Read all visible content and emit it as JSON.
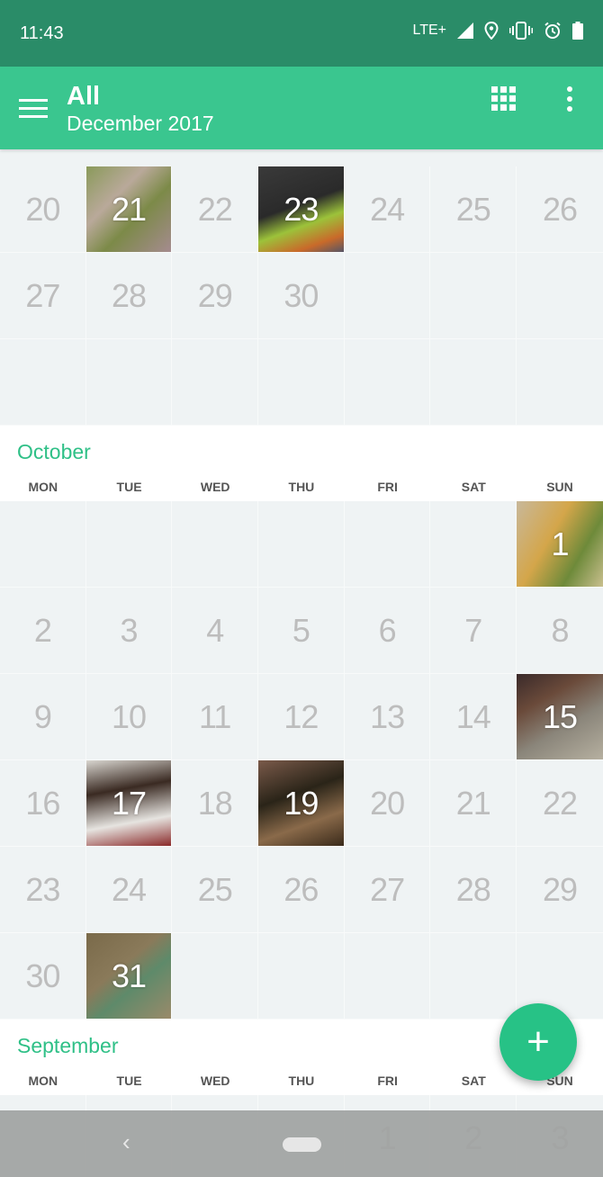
{
  "status_bar": {
    "time": "11:43",
    "network": "LTE+",
    "icons": [
      "signal-icon",
      "location-icon",
      "vibrate-icon",
      "alarm-icon",
      "battery-icon"
    ]
  },
  "app_bar": {
    "title": "All",
    "subtitle": "December 2017",
    "menu_icon": "hamburger-menu-icon",
    "view_icon": "grid-view-icon",
    "more_icon": "more-vert-icon"
  },
  "weekdays": [
    "MON",
    "TUE",
    "WED",
    "THU",
    "FRI",
    "SAT",
    "SUN"
  ],
  "november_partial": {
    "rows": [
      [
        {
          "d": "20"
        },
        {
          "d": "21",
          "photo": "leaves"
        },
        {
          "d": "22"
        },
        {
          "d": "23",
          "photo": "child-eating"
        },
        {
          "d": "24"
        },
        {
          "d": "25"
        },
        {
          "d": "26"
        }
      ],
      [
        {
          "d": "27"
        },
        {
          "d": "28"
        },
        {
          "d": "29"
        },
        {
          "d": "30"
        },
        {
          "d": ""
        },
        {
          "d": ""
        },
        {
          "d": ""
        }
      ],
      [
        {
          "d": ""
        },
        {
          "d": ""
        },
        {
          "d": ""
        },
        {
          "d": ""
        },
        {
          "d": ""
        },
        {
          "d": ""
        },
        {
          "d": ""
        }
      ]
    ]
  },
  "october": {
    "title": "October",
    "rows": [
      [
        {
          "d": ""
        },
        {
          "d": ""
        },
        {
          "d": ""
        },
        {
          "d": ""
        },
        {
          "d": ""
        },
        {
          "d": ""
        },
        {
          "d": "1",
          "photo": "dancer"
        }
      ],
      [
        {
          "d": "2"
        },
        {
          "d": "3"
        },
        {
          "d": "4"
        },
        {
          "d": "5"
        },
        {
          "d": "6"
        },
        {
          "d": "7"
        },
        {
          "d": "8"
        }
      ],
      [
        {
          "d": "9"
        },
        {
          "d": "10"
        },
        {
          "d": "11"
        },
        {
          "d": "12"
        },
        {
          "d": "13"
        },
        {
          "d": "14"
        },
        {
          "d": "15",
          "photo": "steps-person"
        }
      ],
      [
        {
          "d": "16"
        },
        {
          "d": "17",
          "photo": "toddler"
        },
        {
          "d": "18"
        },
        {
          "d": "19",
          "photo": "night-steps"
        },
        {
          "d": "20"
        },
        {
          "d": "21"
        },
        {
          "d": "22"
        }
      ],
      [
        {
          "d": "23"
        },
        {
          "d": "24"
        },
        {
          "d": "25"
        },
        {
          "d": "26"
        },
        {
          "d": "27"
        },
        {
          "d": "28"
        },
        {
          "d": "29"
        }
      ],
      [
        {
          "d": "30"
        },
        {
          "d": "31",
          "photo": "costume"
        },
        {
          "d": ""
        },
        {
          "d": ""
        },
        {
          "d": ""
        },
        {
          "d": ""
        },
        {
          "d": ""
        }
      ]
    ]
  },
  "september": {
    "title": "September",
    "rows": [
      [
        {
          "d": ""
        },
        {
          "d": ""
        },
        {
          "d": ""
        },
        {
          "d": ""
        },
        {
          "d": "1"
        },
        {
          "d": "2"
        },
        {
          "d": "3"
        }
      ]
    ]
  },
  "fab": {
    "label": "+",
    "icon": "add-icon"
  },
  "nav_bar": {
    "back_icon": "back-icon",
    "home_icon": "home-pill-icon"
  },
  "colors": {
    "accent": "#34c48b",
    "status_bar": "#238863",
    "fab": "#27c286",
    "month_title": "#2fc087"
  }
}
